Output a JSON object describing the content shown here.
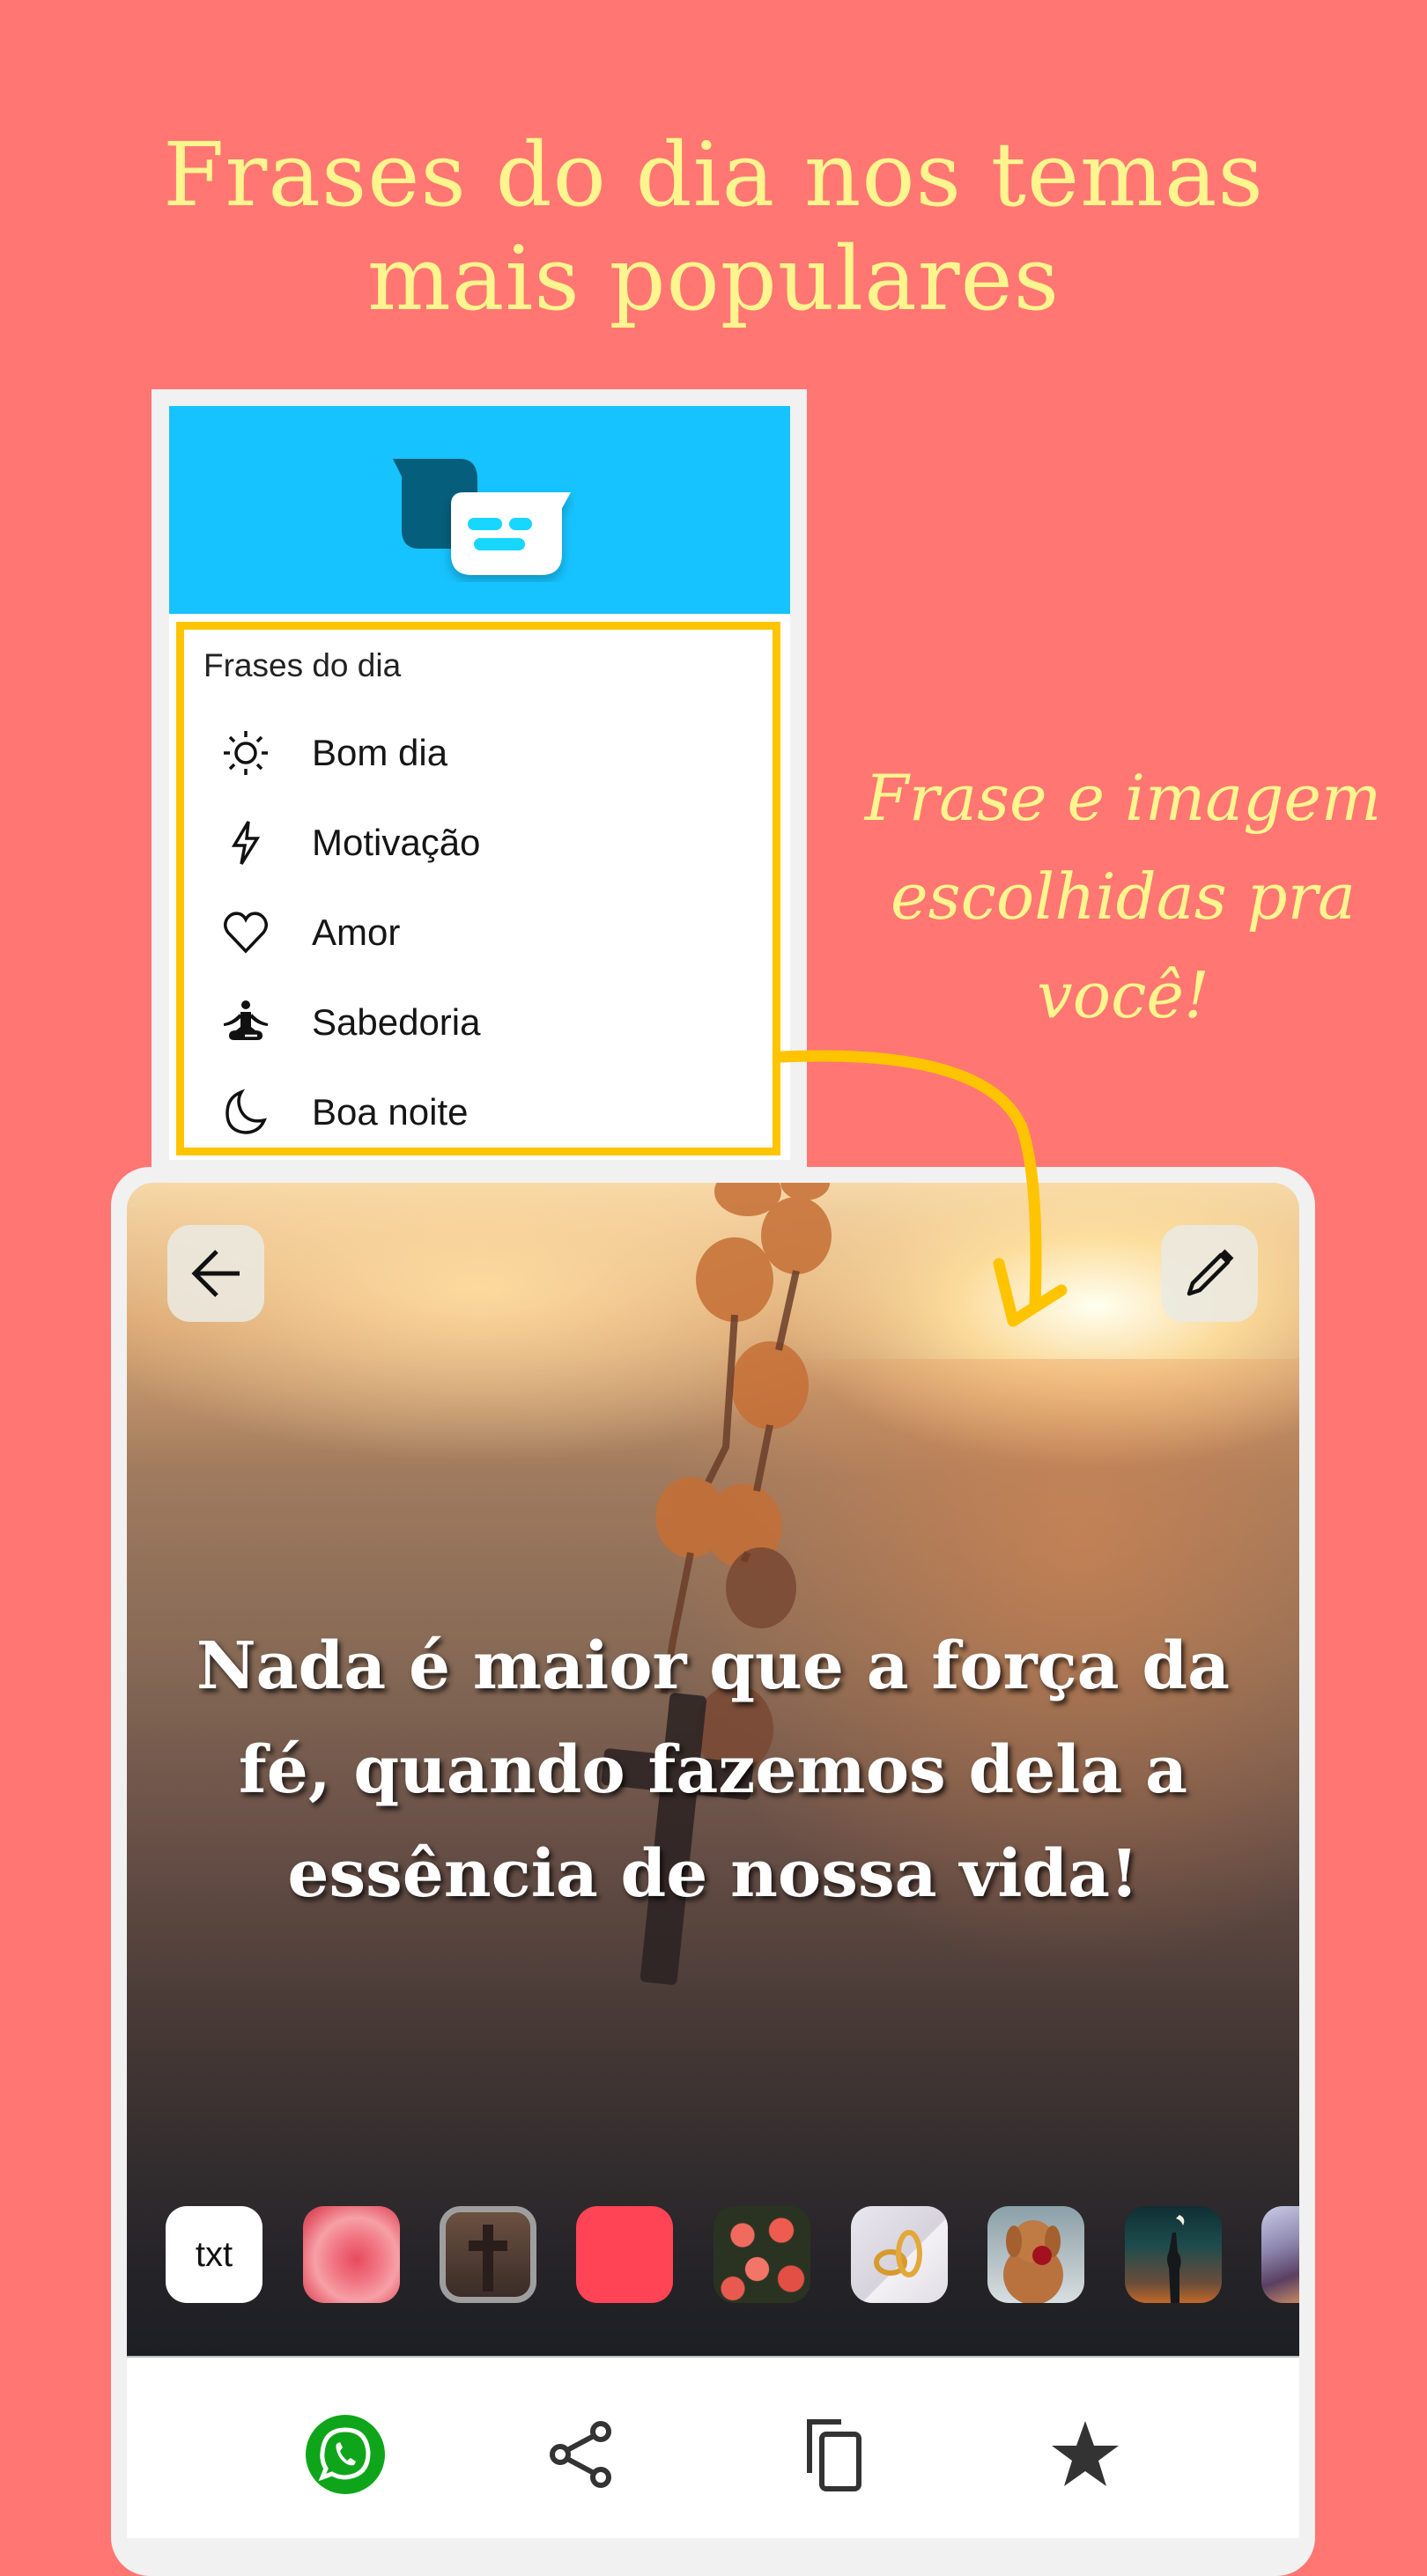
{
  "promo": {
    "headline_lines": [
      "Frases do dia nos temas",
      "mais populares"
    ],
    "script_lines": [
      "Frase e imagem",
      "escolhidas pra",
      "você!"
    ],
    "colors": {
      "background": "#ff7673",
      "headline": "#fff58e",
      "highlight": "#ffc400",
      "drawer_header": "#16c3ff"
    }
  },
  "drawer": {
    "logo_icon": "chat-bubbles-icon",
    "section_title": "Frases do dia",
    "items": [
      {
        "icon": "sun-icon",
        "label": "Bom dia"
      },
      {
        "icon": "lightning-icon",
        "label": "Motivação"
      },
      {
        "icon": "heart-icon",
        "label": "Amor"
      },
      {
        "icon": "meditation-icon",
        "label": "Sabedoria"
      },
      {
        "icon": "moon-icon",
        "label": "Boa noite"
      }
    ]
  },
  "quote_screen": {
    "back_icon": "arrow-left-icon",
    "edit_icon": "pencil-icon",
    "quote_lines": [
      "Nada é maior que a força da",
      "fé, quando fazemos dela a",
      "essência de nossa vida!"
    ],
    "backgrounds": [
      {
        "type": "text",
        "label": "txt"
      },
      {
        "type": "image",
        "name": "pink-rose"
      },
      {
        "type": "image",
        "name": "cross-rosary",
        "selected": true
      },
      {
        "type": "color",
        "name": "red-solid",
        "color": "#ff4455"
      },
      {
        "type": "image",
        "name": "red-roses"
      },
      {
        "type": "image",
        "name": "wedding-rings-book"
      },
      {
        "type": "image",
        "name": "dog-with-rose"
      },
      {
        "type": "image",
        "name": "night-silhouette"
      },
      {
        "type": "image",
        "name": "couple-lights"
      }
    ],
    "actions": [
      {
        "icon": "whatsapp-icon",
        "name": "share-whatsapp"
      },
      {
        "icon": "share-icon",
        "name": "share"
      },
      {
        "icon": "copy-icon",
        "name": "copy"
      },
      {
        "icon": "star-icon",
        "name": "favorite"
      }
    ]
  }
}
